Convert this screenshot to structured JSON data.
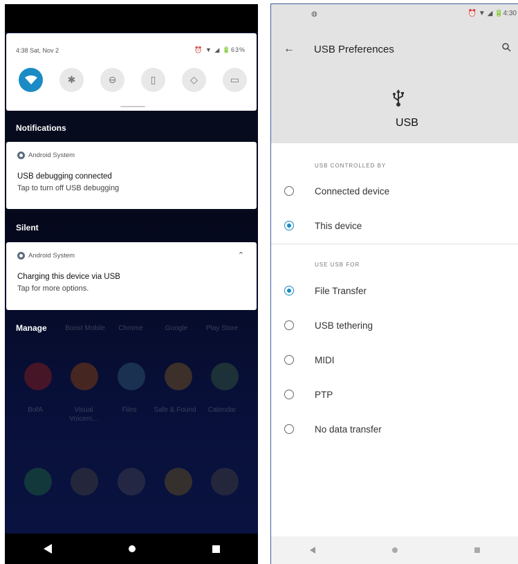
{
  "left": {
    "quick_settings": {
      "time_date": "4:38 Sat, Nov 2",
      "status": "⏰ ▼ ◢ 🔋63%"
    },
    "notifications_header": "Notifications",
    "notif1": {
      "app": "Android System",
      "title": "USB debugging connected",
      "subtitle": "Tap to turn off USB debugging"
    },
    "silent_header": "Silent",
    "notif2": {
      "app": "Android System",
      "title": "Charging this device via USB",
      "subtitle": "Tap for more options."
    },
    "manage_label": "Manage",
    "apps_row1": [
      "Boost Mobile",
      "Chrome",
      "Google",
      "Play Store"
    ],
    "apps_row2": [
      "BofA",
      "Visual Voicem...",
      "Files",
      "Safe & Found",
      "Calendar"
    ]
  },
  "right": {
    "status_time": "4:30",
    "title": "USB Preferences",
    "usb_title": "USB",
    "section1": "USB CONTROLLED BY",
    "controlled_by": [
      {
        "label": "Connected device",
        "checked": false
      },
      {
        "label": "This device",
        "checked": true
      }
    ],
    "section2": "USE USB FOR",
    "use_for": [
      {
        "label": "File Transfer",
        "checked": true
      },
      {
        "label": "USB tethering",
        "checked": false
      },
      {
        "label": "MIDI",
        "checked": false
      },
      {
        "label": "PTP",
        "checked": false
      },
      {
        "label": "No data transfer",
        "checked": false
      }
    ]
  },
  "colors": {
    "accent": "#1a8bc4",
    "header_bg": "#e3e3e3",
    "dark_bg": "#070b1e"
  }
}
